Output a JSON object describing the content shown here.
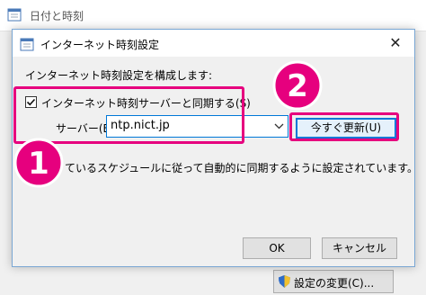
{
  "parent_window": {
    "title": "日付と時刻",
    "change_settings_label": "設定の変更(C)..."
  },
  "dialog": {
    "title": "インターネット時刻設定",
    "close_glyph": "✕",
    "config_label": "インターネット時刻設定を構成します:",
    "sync_checkbox": {
      "label": "インターネット時刻サーバーと同期する(S)",
      "checked": true
    },
    "server": {
      "label": "サーバー(E):",
      "value": "ntp.nict.jp"
    },
    "update_now_label": "今すぐ更新(U)",
    "next_sync_text": "ているスケジュールに従って自動的に同期するように設定されています。",
    "ok_label": "OK",
    "cancel_label": "キャンセル"
  },
  "annotations": {
    "marker_1": "1",
    "marker_2": "2",
    "accent_color": "#e6007e"
  },
  "icons": {
    "parent_window": "clock-calendar-icon",
    "dialog": "clock-calendar-icon",
    "checkbox": "checkmark-icon",
    "dropdown": "chevron-down-icon",
    "uac_shield": "uac-shield-icon"
  }
}
